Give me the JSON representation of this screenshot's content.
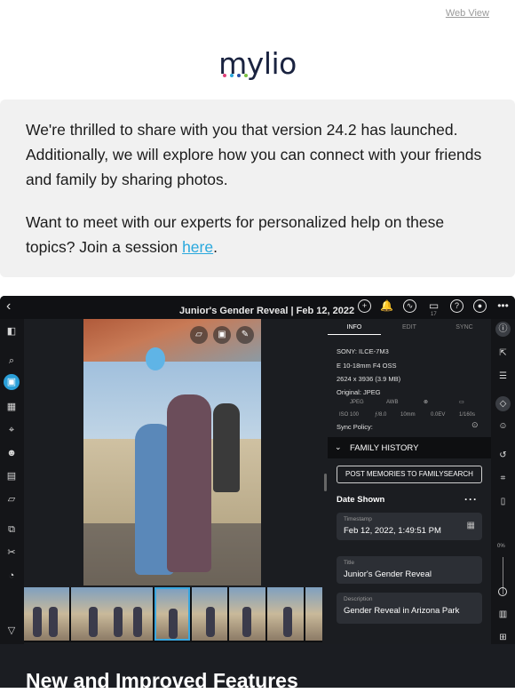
{
  "header": {
    "web_view": "Web View",
    "logo_text": "mylio",
    "logo_dot_colors": [
      "#e0407a",
      "#29a8dd",
      "#2a4fa8",
      "#7ac142"
    ]
  },
  "intro": {
    "para1": "We're thrilled to share with you that version 24.2 has launched. Additionally, we will explore how you can connect with your friends and family by sharing photos.",
    "para2_before": "Want to meet with our experts for personalized help on these topics? Join a session ",
    "para2_link": "here",
    "para2_after": "."
  },
  "app": {
    "title": "Junior's Gender Reveal | Feb 12, 2022",
    "badge": "17",
    "tabs": [
      "INFO",
      "EDIT",
      "SYNC"
    ],
    "meta": {
      "camera": "SONY: ILCE-7M3",
      "lens": "E 10-18mm F4 OSS",
      "dimensions": "2624 x 3936 (3.9 MB)",
      "original": "Original: JPEG",
      "format": "JPEG",
      "wb": "AWB",
      "iso": "ISO 100",
      "aperture": "ƒ/8.0",
      "focal": "10mm",
      "ev": "0.0EV",
      "shutter": "1/160s",
      "sync_policy": "Sync Policy:"
    },
    "family_history": "FAMILY HISTORY",
    "post_button": "POST MEMORIES TO FAMILYSEARCH",
    "date_shown": "Date Shown",
    "fields": [
      {
        "label": "Timestamp",
        "value": "Feb 12, 2022, 1:49:51 PM"
      },
      {
        "label": "Title",
        "value": "Junior's Gender Reveal"
      },
      {
        "label": "Description",
        "value": "Gender Reveal in Arizona Park"
      }
    ],
    "zoom": "0%"
  },
  "footer": {
    "heading": "New and Improved Features"
  }
}
